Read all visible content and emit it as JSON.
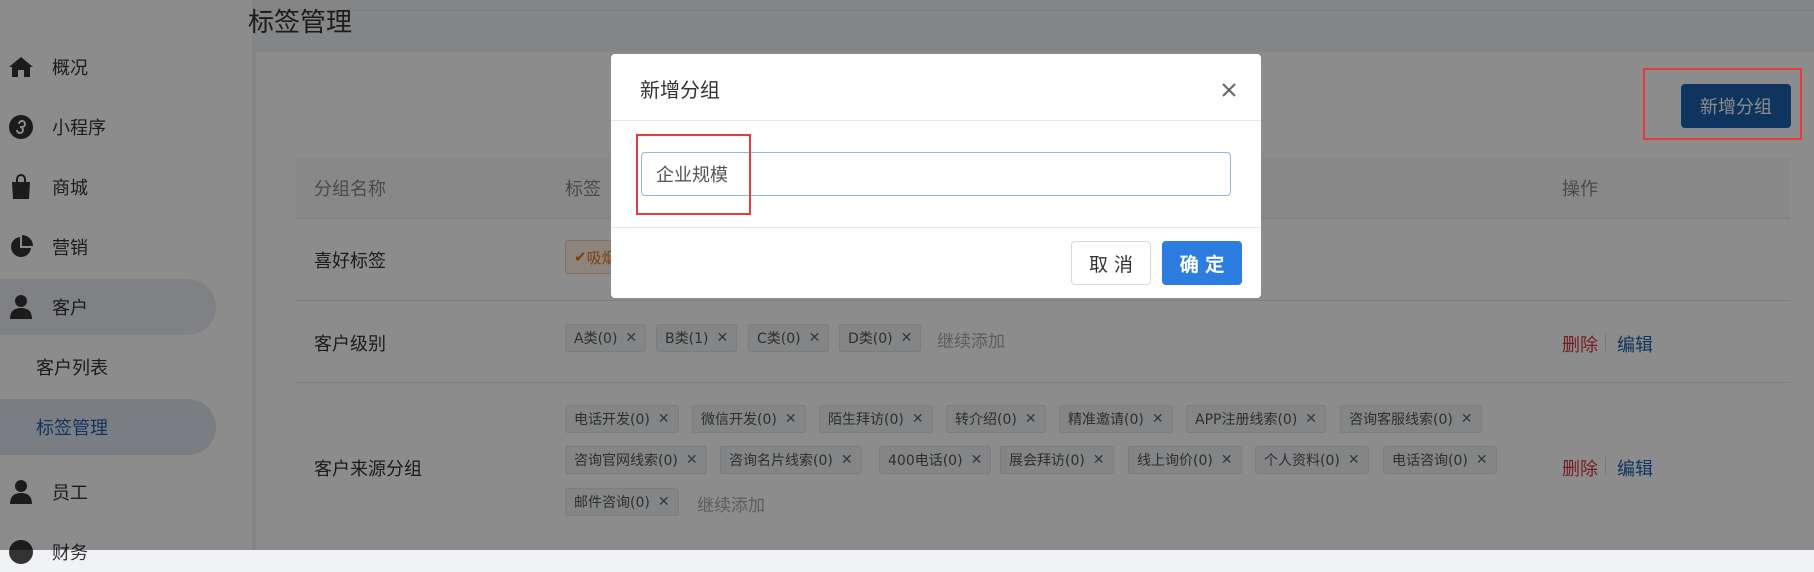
{
  "page": {
    "title": "标签管理"
  },
  "sidebar": {
    "items": [
      {
        "label": "概况",
        "icon": "home-icon"
      },
      {
        "label": "小程序",
        "icon": "mini-program-icon"
      },
      {
        "label": "商城",
        "icon": "shopping-bag-icon"
      },
      {
        "label": "营销",
        "icon": "pie-chart-icon"
      },
      {
        "label": "客户",
        "icon": "user-icon"
      },
      {
        "label": "员工",
        "icon": "user-icon"
      },
      {
        "label": "财务",
        "icon": "finance-icon"
      }
    ],
    "sub_items": [
      {
        "label": "客户列表"
      },
      {
        "label": "标签管理"
      }
    ]
  },
  "toolbar": {
    "new_group_label": "新增分组"
  },
  "table": {
    "headers": {
      "name": "分组名称",
      "tags": "标签",
      "actions": "操作"
    },
    "rows": [
      {
        "name": "喜好标签",
        "first_tag": "吸烟"
      },
      {
        "name": "客户级别",
        "tags": [
          "A类(0)",
          "B类(1)",
          "C类(0)",
          "D类(0)"
        ],
        "add_more": "继续添加",
        "delete": "删除",
        "edit": "编辑"
      },
      {
        "name": "客户来源分组",
        "tags": [
          "电话开发(0)",
          "微信开发(0)",
          "陌生拜访(0)",
          "转介绍(0)",
          "精准邀请(0)",
          "APP注册线索(0)",
          "咨询客服线索(0)",
          "咨询官网线索(0)",
          "咨询名片线索(0)",
          "400电话(0)",
          "展会拜访(0)",
          "线上询价(0)",
          "个人资料(0)",
          "电话咨询(0)",
          "邮件咨询(0)"
        ],
        "add_more": "继续添加",
        "delete": "删除",
        "edit": "编辑"
      }
    ]
  },
  "modal": {
    "title": "新增分组",
    "input_value": "企业规模",
    "cancel_label": "取 消",
    "ok_label": "确 定"
  },
  "colors": {
    "primary": "#2d7de0",
    "brand": "#1d5fae",
    "danger": "#d9363e",
    "highlight": "#e43c3c"
  }
}
